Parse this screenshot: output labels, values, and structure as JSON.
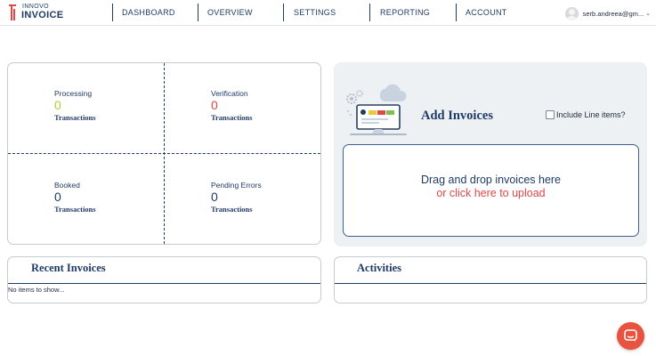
{
  "logo": {
    "brand_top": "INNOVO",
    "brand_bottom": "INVOICE"
  },
  "nav": {
    "items": [
      {
        "label": "DASHBOARD"
      },
      {
        "label": "OVERVIEW"
      },
      {
        "label": "SETTINGS"
      },
      {
        "label": "REPORTING"
      },
      {
        "label": "ACCOUNT"
      }
    ]
  },
  "user": {
    "name": "serb.andreea@gm...",
    "caret": "⌄"
  },
  "stats": {
    "processing": {
      "label": "Processing",
      "value": "0",
      "sub": "Transactions",
      "color": "#b8cc2a"
    },
    "verification": {
      "label": "Verification",
      "value": "0",
      "sub": "Transactions",
      "color": "#e04848"
    },
    "booked": {
      "label": "Booked",
      "value": "0",
      "sub": "Transactions",
      "color": "#1f3a66"
    },
    "pending": {
      "label": "Pending Errors",
      "value": "0",
      "sub": "Transactions",
      "color": "#1f3a66"
    }
  },
  "add_invoices": {
    "title": "Add Invoices",
    "include_label": "Include Line items?",
    "include_checked": false,
    "drop_text": "Drag and drop invoices here",
    "upload_text": "or click here to upload"
  },
  "recent": {
    "title": "Recent Invoices",
    "empty": "No items to show..."
  },
  "activities": {
    "title": "Activities"
  },
  "colors": {
    "primary": "#1f3a66",
    "accent_red": "#e04848",
    "accent_green": "#b8cc2a",
    "chat": "#e8523e"
  },
  "icons": {
    "chat": "chat-bubble-icon",
    "avatar": "user-avatar-icon"
  }
}
